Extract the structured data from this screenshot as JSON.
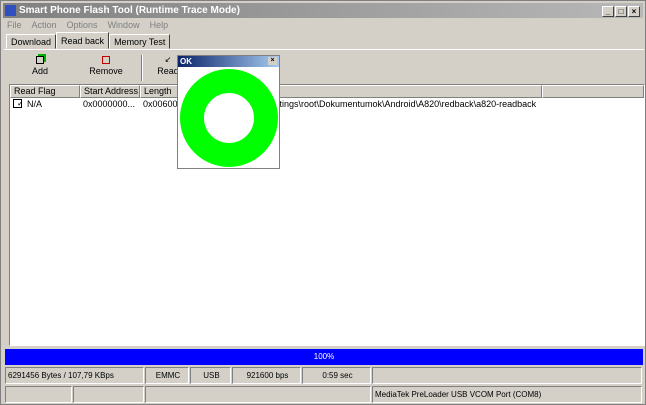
{
  "window": {
    "title": "Smart Phone Flash Tool (Runtime Trace Mode)",
    "minimize": "_",
    "maximize": "□",
    "close": "×"
  },
  "menu": [
    "File",
    "Action",
    "Options",
    "Window",
    "Help"
  ],
  "tabs": [
    "Download",
    "Read back",
    "Memory Test"
  ],
  "toolbar": {
    "add": "Add",
    "remove": "Remove",
    "read": "Read"
  },
  "list": {
    "headers": [
      "Read Flag",
      "Start Address",
      "Length",
      "",
      ""
    ],
    "rows": [
      {
        "flag": "N/A",
        "start": "0x0000000...",
        "length": "0x006000",
        "path": "ttings\\root\\Dokumentumok\\Android\\A820\\redback\\a820-readback"
      }
    ]
  },
  "progress": {
    "label": "100%",
    "value": 100,
    "color": "#0000ff"
  },
  "status": {
    "row1": [
      "6291456 Bytes / 107,79 KBps",
      "EMMC",
      "USB",
      "921600 bps",
      "0:59 sec",
      ""
    ],
    "row2": [
      "",
      "",
      "",
      "MediaTek PreLoader USB VCOM Port (COM8)"
    ]
  },
  "popup": {
    "title": "OK",
    "ring_color": "#00ff00"
  }
}
